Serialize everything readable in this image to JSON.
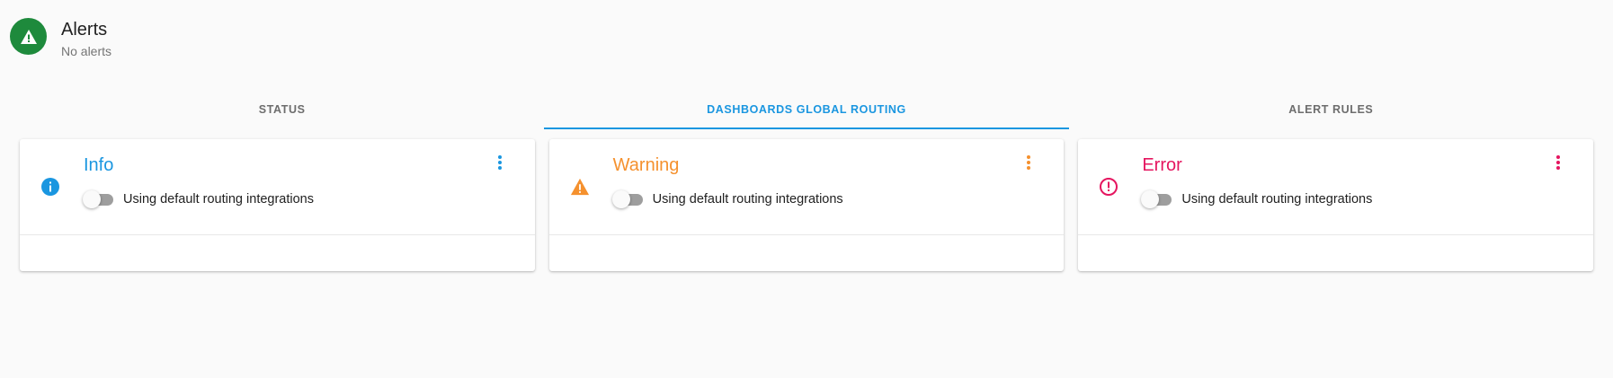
{
  "header": {
    "title": "Alerts",
    "subtitle": "No alerts",
    "icon": "warning-icon",
    "icon_bg": "#1e8a3c"
  },
  "tabs": [
    {
      "label": "STATUS",
      "active": false
    },
    {
      "label": "DASHBOARDS GLOBAL ROUTING",
      "active": true
    },
    {
      "label": "ALERT RULES",
      "active": false
    }
  ],
  "accent": "#1a96e0",
  "cards": [
    {
      "title": "Info",
      "color": "#1a96e0",
      "icon": "info-icon",
      "toggle_label": "Using default routing integrations",
      "toggle_on": false
    },
    {
      "title": "Warning",
      "color": "#f5912e",
      "icon": "warning-icon",
      "toggle_label": "Using default routing integrations",
      "toggle_on": false
    },
    {
      "title": "Error",
      "color": "#e5155f",
      "icon": "error-icon",
      "toggle_label": "Using default routing integrations",
      "toggle_on": false
    }
  ]
}
